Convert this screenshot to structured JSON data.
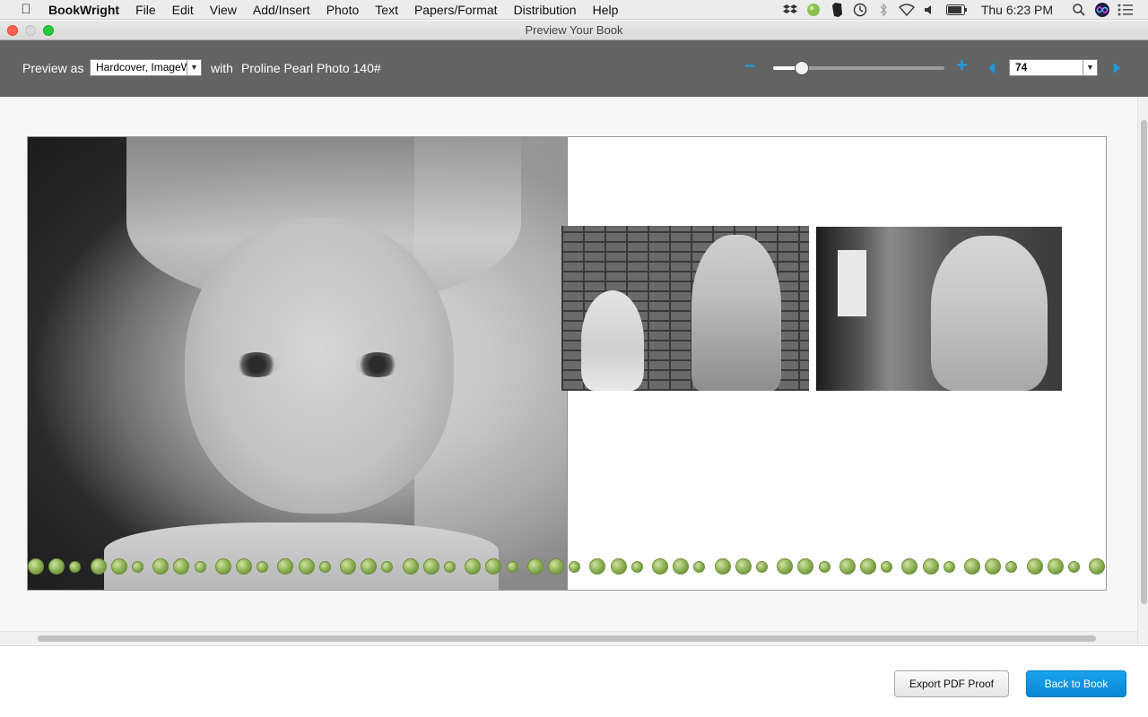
{
  "menubar": {
    "app_name": "BookWright",
    "items": [
      "File",
      "Edit",
      "View",
      "Add/Insert",
      "Photo",
      "Text",
      "Papers/Format",
      "Distribution",
      "Help"
    ],
    "clock": "Thu 6:23 PM"
  },
  "window": {
    "title": "Preview Your Book"
  },
  "toolbar": {
    "preview_as_label": "Preview as",
    "format_select_value": "Hardcover, ImageWrap",
    "with_label": "with",
    "paper_name": "Proline Pearl Photo 140#",
    "zoom_minus": "−",
    "zoom_plus": "+",
    "zoom_level": 0.17,
    "page_number": "74"
  },
  "buttons": {
    "export_pdf": "Export PDF Proof",
    "back_to_book": "Back to Book"
  },
  "colors": {
    "accent_blue": "#1e9be0",
    "toolbar_gray": "#636363",
    "garland_green": "#93b65a"
  },
  "icons": {
    "apple": "apple-logo-icon",
    "status": [
      "dropbox-icon",
      "green-dot-icon",
      "evernote-icon",
      "time-machine-icon",
      "bluetooth-icon",
      "wifi-icon",
      "volume-icon",
      "battery-icon",
      "search-icon",
      "siri-icon",
      "notification-center-icon"
    ]
  }
}
